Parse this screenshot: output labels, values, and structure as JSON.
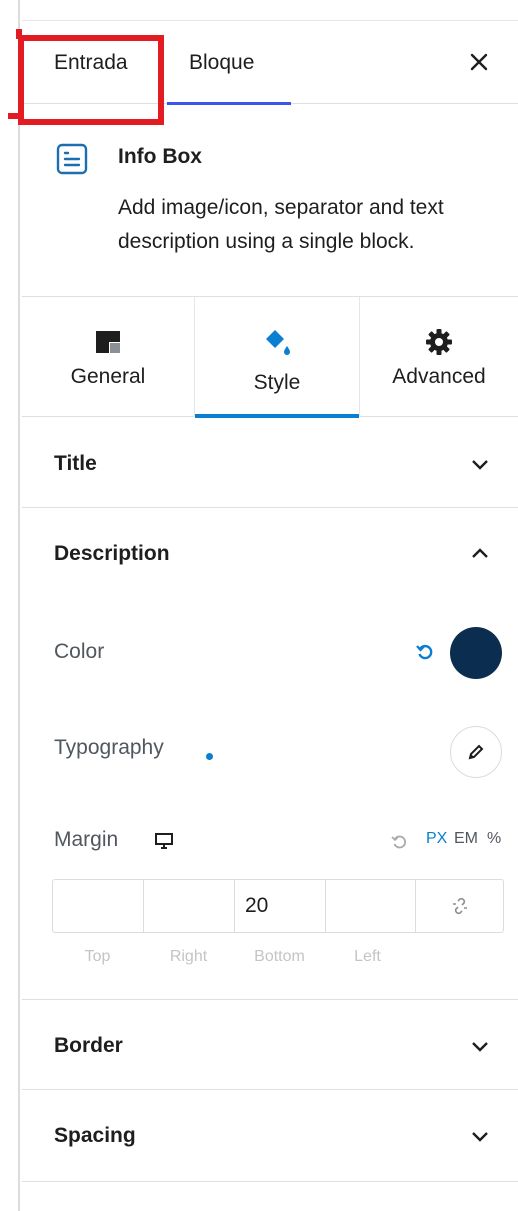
{
  "header": {
    "tabs": [
      {
        "label": "Entrada"
      },
      {
        "label": "Bloque"
      }
    ],
    "close_icon": "close-icon"
  },
  "block": {
    "icon": "info-box-icon",
    "title": "Info Box",
    "description": "Add image/icon, separator and text description using a single block."
  },
  "inspector_tabs": [
    {
      "label": "General",
      "icon": "general-icon"
    },
    {
      "label": "Style",
      "icon": "paint-bucket-icon"
    },
    {
      "label": "Advanced",
      "icon": "gear-icon"
    }
  ],
  "sections": {
    "title": {
      "label": "Title",
      "expanded": false
    },
    "description": {
      "label": "Description",
      "expanded": true,
      "color_label": "Color",
      "color_value": "#0b2d4f",
      "typography_label": "Typography",
      "margin_label": "Margin",
      "units": [
        "PX",
        "EM",
        "%"
      ],
      "selected_unit": "PX",
      "margin_values": {
        "top": "",
        "right": "",
        "bottom": "20",
        "left": ""
      },
      "margin_captions": [
        "Top",
        "Right",
        "Bottom",
        "Left"
      ]
    },
    "border": {
      "label": "Border",
      "expanded": false
    },
    "spacing": {
      "label": "Spacing",
      "expanded": false
    }
  },
  "colors": {
    "accent": "#0a7ed0",
    "tab_underline": "#3858e9",
    "highlight": "#e31c23"
  }
}
